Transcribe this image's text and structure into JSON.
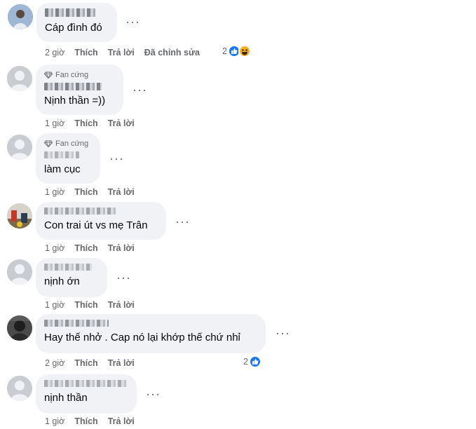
{
  "labels": {
    "like": "Thích",
    "reply": "Trả lời",
    "edited": "Đã chỉnh sửa",
    "fan": "Fan cứng"
  },
  "comments": [
    {
      "text": "Cáp đình đó",
      "time": "2 giờ",
      "reaction_count": "2",
      "reactions": [
        "like-icon",
        "haha-icon"
      ],
      "edited": true
    },
    {
      "text": "Nịnh thần =))",
      "time": "1 giờ",
      "fan": true
    },
    {
      "text": "làm cục",
      "time": "1 giờ",
      "fan": true
    },
    {
      "text": "Con trai út vs mẹ Trân",
      "time": "1 giờ"
    },
    {
      "text": "nịnh ớn",
      "time": "1 giờ"
    },
    {
      "text": "Hay thế nhở . Cap nó lại khớp thế chứ nhỉ",
      "time": "2 giờ",
      "reaction_count": "2",
      "reactions": [
        "like-icon"
      ]
    },
    {
      "text": "nịnh thần",
      "time": "1 giờ"
    }
  ],
  "colors": {
    "bubble": "#f0f2f5",
    "meta": "#65676b",
    "like": "#1877f2",
    "haha": "#f7b125"
  }
}
